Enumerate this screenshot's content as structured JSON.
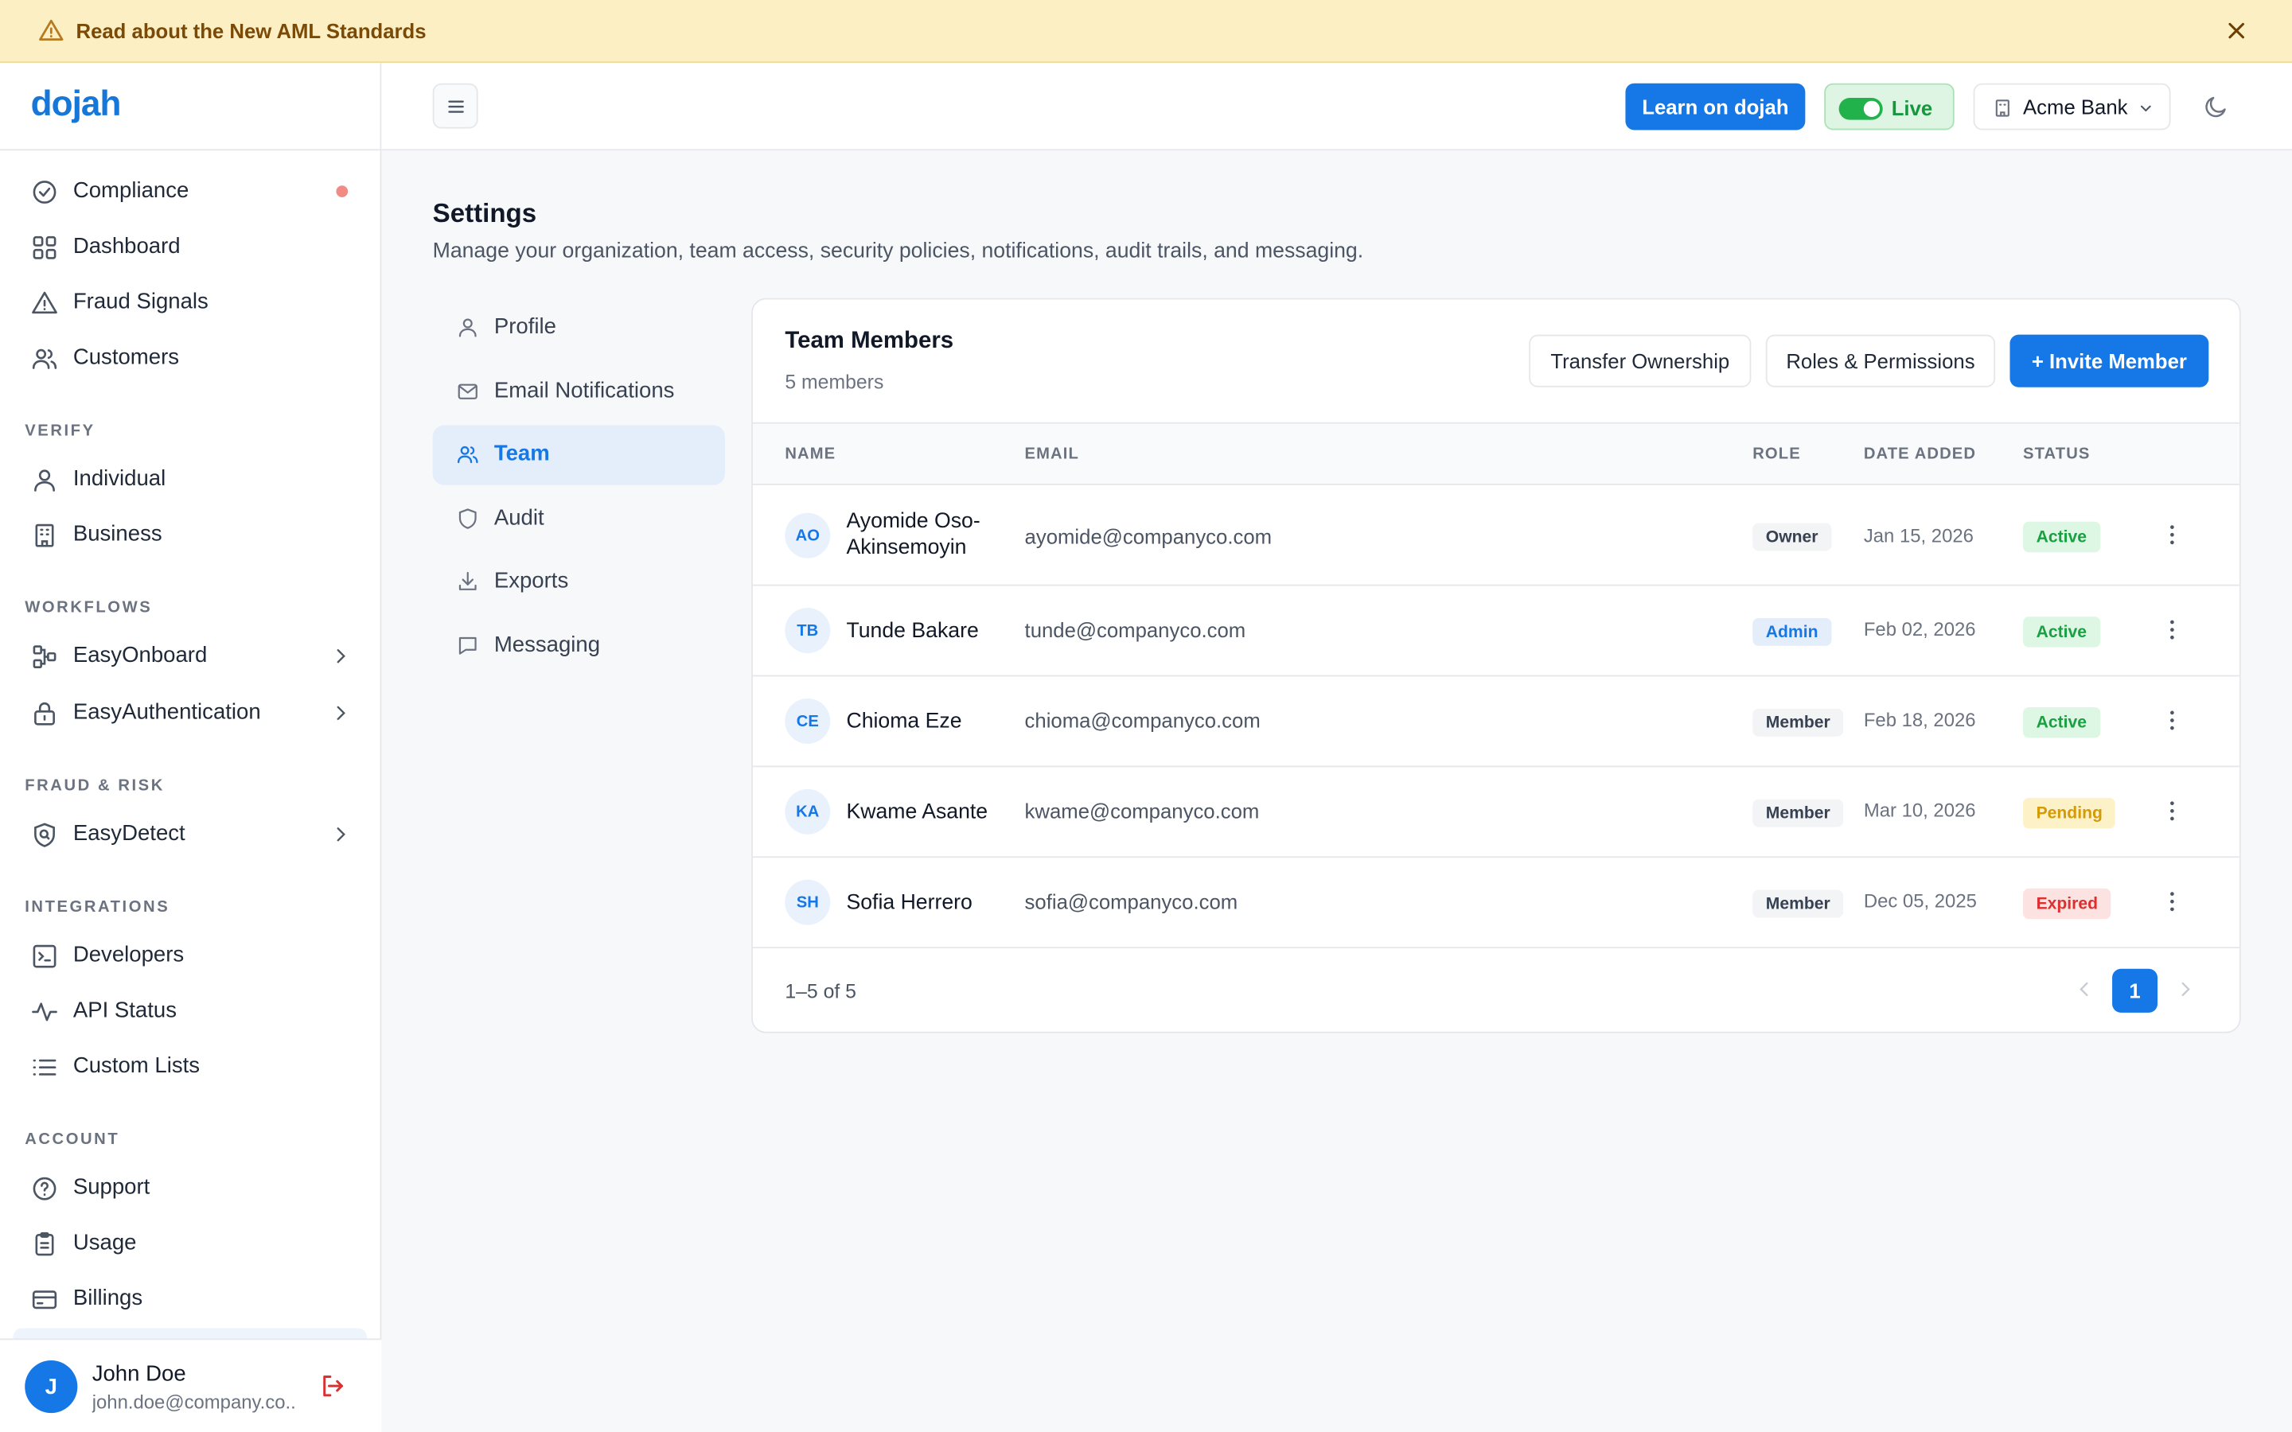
{
  "banner": {
    "text": "Read about the New AML Standards",
    "icon": "warning-icon"
  },
  "brand": {
    "logo": "dojah",
    "accent": "#1677e6"
  },
  "sidebar": {
    "items": [
      {
        "label": "Compliance",
        "icon": "check-circle-icon",
        "alert": true
      },
      {
        "label": "Dashboard",
        "icon": "grid-icon"
      },
      {
        "label": "Fraud Signals",
        "icon": "warning-icon"
      },
      {
        "label": "Customers",
        "icon": "users-icon"
      }
    ],
    "sections": [
      {
        "title": "VERIFY",
        "items": [
          {
            "label": "Individual",
            "icon": "user-icon"
          },
          {
            "label": "Business",
            "icon": "building-icon"
          }
        ]
      },
      {
        "title": "WORKFLOWS",
        "items": [
          {
            "label": "EasyOnboard",
            "icon": "workflow-icon"
          },
          {
            "label": "EasyAuthentication",
            "icon": "lock-icon"
          }
        ]
      },
      {
        "title": "FRAUD & RISK",
        "items": [
          {
            "label": "EasyDetect",
            "icon": "shield-search-icon"
          }
        ]
      },
      {
        "title": "INTEGRATIONS",
        "items": [
          {
            "label": "Developers",
            "icon": "terminal-icon"
          },
          {
            "label": "API Status",
            "icon": "pulse-icon"
          },
          {
            "label": "Custom Lists",
            "icon": "list-icon"
          }
        ]
      },
      {
        "title": "ACCOUNT",
        "items": [
          {
            "label": "Support",
            "icon": "help-circle-icon"
          },
          {
            "label": "Usage",
            "icon": "clipboard-icon"
          },
          {
            "label": "Billings",
            "icon": "credit-card-icon"
          }
        ]
      }
    ],
    "user": {
      "initial": "J",
      "name": "John Doe",
      "email": "john.doe@company.co..."
    }
  },
  "topbar": {
    "learn_label": "Learn on dojah",
    "live_label": "Live",
    "live_on": true,
    "org_label": "Acme Bank"
  },
  "settings": {
    "title": "Settings",
    "subtitle": "Manage your organization, team access, security policies, notifications, audit trails, and messaging.",
    "nav": [
      {
        "label": "Profile",
        "icon": "user-icon"
      },
      {
        "label": "Email Notifications",
        "icon": "mail-icon"
      },
      {
        "label": "Team",
        "icon": "users-icon",
        "active": true
      },
      {
        "label": "Audit",
        "icon": "shield-icon"
      },
      {
        "label": "Exports",
        "icon": "download-icon"
      },
      {
        "label": "Messaging",
        "icon": "chat-icon"
      }
    ]
  },
  "team": {
    "title": "Team Members",
    "count": "5 members",
    "transfer_label": "Transfer Ownership",
    "roles_label": "Roles & Permissions",
    "invite_label": "+ Invite Member",
    "columns": {
      "name": "NAME",
      "email": "EMAIL",
      "role": "ROLE",
      "date": "DATE ADDED",
      "status": "STATUS"
    },
    "members": [
      {
        "initials": "AO",
        "name": "Ayomide Oso-Akinsemoyin",
        "email": "ayomide@companyco.com",
        "role": "Owner",
        "date": "Jan 15, 2026",
        "status": "Active"
      },
      {
        "initials": "TB",
        "name": "Tunde Bakare",
        "email": "tunde@companyco.com",
        "role": "Admin",
        "date": "Feb 02, 2026",
        "status": "Active"
      },
      {
        "initials": "CE",
        "name": "Chioma Eze",
        "email": "chioma@companyco.com",
        "role": "Member",
        "date": "Feb 18, 2026",
        "status": "Active"
      },
      {
        "initials": "KA",
        "name": "Kwame Asante",
        "email": "kwame@companyco.com",
        "role": "Member",
        "date": "Mar 10, 2026",
        "status": "Pending"
      },
      {
        "initials": "SH",
        "name": "Sofia Herrero",
        "email": "sofia@companyco.com",
        "role": "Member",
        "date": "Dec 05, 2025",
        "status": "Expired"
      }
    ],
    "range": "1–5 of 5",
    "page": "1"
  }
}
